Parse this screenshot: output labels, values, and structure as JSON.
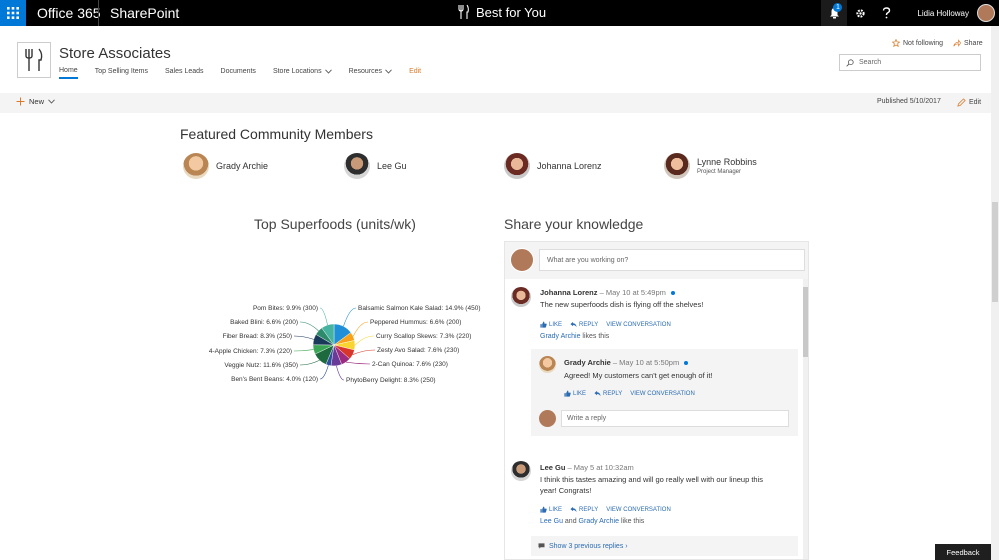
{
  "suite": {
    "app_name": "Office 365",
    "product": "SharePoint",
    "center_title": "Best for You",
    "notification_count": "1",
    "user_name": "Lidia Holloway"
  },
  "site": {
    "title": "Store Associates",
    "nav": [
      "Home",
      "Top Selling Items",
      "Sales Leads",
      "Documents",
      "Store Locations",
      "Resources",
      "Edit"
    ],
    "follow_label": "Not following",
    "share_label": "Share",
    "search_placeholder": "Search"
  },
  "command_bar": {
    "new_label": "New",
    "published": "Published 5/10/2017",
    "edit_label": "Edit"
  },
  "featured": {
    "title": "Featured Community Members",
    "members": [
      {
        "name": "Grady Archie",
        "subtitle": ""
      },
      {
        "name": "Lee Gu",
        "subtitle": ""
      },
      {
        "name": "Johanna Lorenz",
        "subtitle": ""
      },
      {
        "name": "Lynne Robbins",
        "subtitle": "Project Manager"
      }
    ]
  },
  "chart_data": {
    "type": "pie",
    "title": "Top Superfoods (units/wk)",
    "slices": [
      {
        "label": "Balsamic Salmon Kale Salad",
        "value": 450,
        "percent": 14.9,
        "color": "#1f8fd8"
      },
      {
        "label": "Peppered Hummus",
        "value": 200,
        "percent": 6.6,
        "color": "#f7a21b"
      },
      {
        "label": "Curry Scallop Skews",
        "value": 220,
        "percent": 7.3,
        "color": "#f8d531"
      },
      {
        "label": "Zesty Avo Salad",
        "value": 230,
        "percent": 7.6,
        "color": "#d8352b"
      },
      {
        "label": "2-Can Quinoa",
        "value": 230,
        "percent": 7.6,
        "color": "#9c2a7e"
      },
      {
        "label": "PhytoBerry Delight",
        "value": 250,
        "percent": 8.3,
        "color": "#6a3a98"
      },
      {
        "label": "Ben's Bent Beans",
        "value": 120,
        "percent": 4.0,
        "color": "#2f4f9e"
      },
      {
        "label": "Veggie Nutz",
        "value": 350,
        "percent": 11.6,
        "color": "#1c6a3e"
      },
      {
        "label": "4-Apple Chicken",
        "value": 220,
        "percent": 7.3,
        "color": "#3aa655"
      },
      {
        "label": "Fiber Bread",
        "value": 250,
        "percent": 8.3,
        "color": "#1a3a5a"
      },
      {
        "label": "Baked Blini",
        "value": 200,
        "percent": 6.6,
        "color": "#2d8a6a"
      },
      {
        "label": "Pom Bites",
        "value": 300,
        "percent": 9.9,
        "color": "#45b3a0"
      }
    ],
    "labels_text": [
      "Balsamic Salmon Kale Salad: 14.9% (450)",
      "Peppered Hummus: 6.6% (200)",
      "Curry Scallop Skews: 7.3% (220)",
      "Zesty Avo Salad: 7.6% (230)",
      "2-Can Quinoa: 7.6% (230)",
      "PhytoBerry Delight: 8.3% (250)",
      "Ben's Bent Beans: 4.0% (120)",
      "Veggie Nutz: 11.6% (350)",
      "4-Apple Chicken: 7.3% (220)",
      "Fiber Bread: 8.3% (250)",
      "Baked Blini: 6.6% (200)",
      "Pom Bites: 9.9% (300)"
    ]
  },
  "feed": {
    "title": "Share your knowledge",
    "composer_placeholder": "What are you working on?",
    "posts": [
      {
        "author": "Johanna Lorenz",
        "meta": " – May 10 at 5:49pm",
        "text": "The new superfoods dish is flying off the shelves!",
        "like": "LIKE",
        "reply": "REPLY",
        "view": "VIEW CONVERSATION",
        "liked_by": "Grady Archie",
        "liked_suffix": " likes this"
      },
      {
        "author": "Grady Archie",
        "meta": " – May 10 at 5:50pm",
        "text": "Agreed! My customers can't get enough of it!",
        "like": "LIKE",
        "reply": "REPLY",
        "view": "VIEW CONVERSATION"
      },
      {
        "author": "Lee Gu",
        "meta": " – May 5 at 10:32am",
        "text": "I think this tastes amazing and will go really well with our lineup this year! Congrats!",
        "like": "LIKE",
        "reply": "REPLY",
        "view": "VIEW CONVERSATION",
        "liked_by": "Lee Gu",
        "liked_and": " and ",
        "liked_by2": "Grady Archie",
        "liked_suffix": " like this"
      }
    ],
    "reply_placeholder": "Write a reply",
    "show_more": "Show 3 previous replies ›"
  },
  "feedback_label": "Feedback"
}
